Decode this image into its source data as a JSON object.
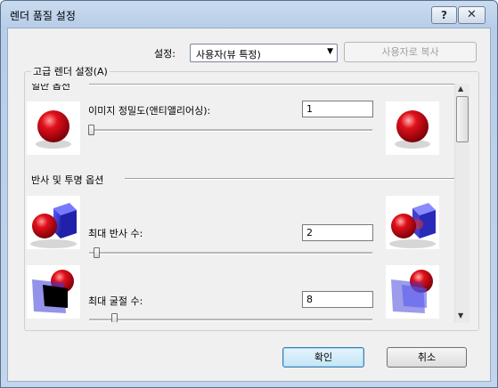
{
  "window": {
    "title": "렌더 품질 설정",
    "help_label": "?",
    "close_label": "✕"
  },
  "preset": {
    "label": "설정:",
    "value": "사용자(뷰 특정)",
    "copy_button": "사용자로 복사"
  },
  "group": {
    "title": "고급 렌더 설정(A)"
  },
  "sections": {
    "general": "일반 옵션",
    "reflection": "반사 및 투명 옵션"
  },
  "settings": [
    {
      "label": "이미지 정밀도(앤티앨리어싱):",
      "value": "1",
      "level": 0.0
    },
    {
      "label": "최대 반사 수:",
      "value": "2",
      "level": 0.03
    },
    {
      "label": "최대 굴절 수:",
      "value": "8",
      "level": 0.1
    }
  ],
  "buttons": {
    "ok": "확인",
    "cancel": "취소"
  },
  "colors": {
    "accent": "#3c7fb1",
    "sphere": "#e0101a",
    "cube": "#3a3ad8"
  }
}
